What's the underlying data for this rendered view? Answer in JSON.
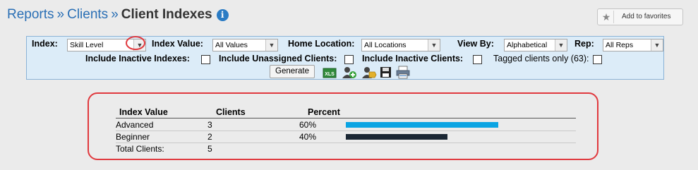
{
  "breadcrumb": {
    "reports": "Reports",
    "separator": "»",
    "clients": "Clients",
    "current": "Client Indexes",
    "info_glyph": "i"
  },
  "favorites": {
    "label": "Add to favorites",
    "icon": "star-icon"
  },
  "filters": {
    "index_label": "Index:",
    "index_value": "Skill Level",
    "index_value_label": "Index Value:",
    "index_value_value": "All Values",
    "home_location_label": "Home Location:",
    "home_location_value": "All Locations",
    "view_by_label": "View By:",
    "view_by_value": "Alphabetical",
    "rep_label": "Rep:",
    "rep_value": "All Reps",
    "include_inactive_indexes_label": "Include Inactive Indexes:",
    "include_unassigned_label": "Include Unassigned Clients:",
    "include_inactive_clients_label": "Include Inactive Clients:",
    "tagged_only_label": "Tagged clients only (63):",
    "generate_label": "Generate",
    "xls_label": "XLS",
    "dropdown_arrow": "▼"
  },
  "results": {
    "headers": {
      "index_value": "Index Value",
      "clients": "Clients",
      "percent": "Percent"
    },
    "rows": [
      {
        "name": "Advanced",
        "clients": "3",
        "percent": "60%",
        "fraction": 0.6,
        "color": "#0aa4e3"
      },
      {
        "name": "Beginner",
        "clients": "2",
        "percent": "40%",
        "fraction": 0.4,
        "color": "#1b2734"
      }
    ],
    "total_label": "Total Clients:",
    "total_value": "5"
  },
  "colors": {
    "link": "#2a6fb5",
    "highlight": "#e0393e",
    "panel": "#dcecf8"
  }
}
